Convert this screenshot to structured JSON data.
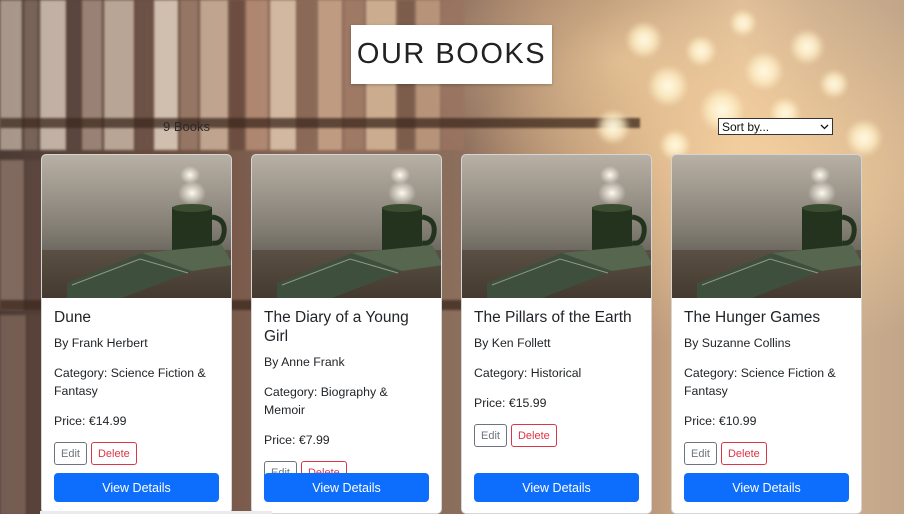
{
  "header": {
    "title": "OUR BOOKS"
  },
  "toolbar": {
    "count_label": "9 Books",
    "sort_placeholder": "Sort by..."
  },
  "books": [
    {
      "title": "Dune",
      "author": "By Frank Herbert",
      "category": "Category: Science Fiction & Fantasy",
      "price": "Price: €14.99"
    },
    {
      "title": "The Diary of a Young Girl",
      "author": "By Anne Frank",
      "category": "Category: Biography & Memoir",
      "price": "Price: €7.99"
    },
    {
      "title": "The Pillars of the Earth",
      "author": "By Ken Follett",
      "category": "Category: Historical",
      "price": "Price: €15.99"
    },
    {
      "title": "The Hunger Games",
      "author": "By Suzanne Collins",
      "category": "Category: Science Fiction & Fantasy",
      "price": "Price: €10.99"
    }
  ],
  "card_actions": {
    "edit_label": "Edit",
    "delete_label": "Delete",
    "view_label": "View Details"
  },
  "colors": {
    "primary": "#0d6efd",
    "danger": "#dc3545",
    "secondary": "#6c757d"
  },
  "icons": {
    "sort_chevron": "chevron-down-icon"
  }
}
